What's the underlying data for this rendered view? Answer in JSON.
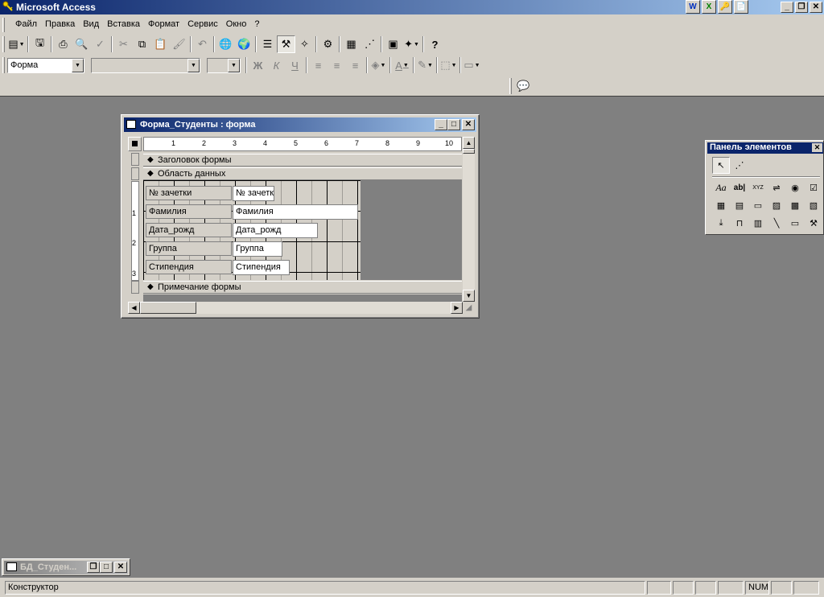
{
  "app": {
    "title": "Microsoft Access",
    "ext_icons": [
      "W",
      "X",
      "🔑",
      "📄"
    ]
  },
  "menu": {
    "items": [
      "Файл",
      "Правка",
      "Вид",
      "Вставка",
      "Формат",
      "Сервис",
      "Окно",
      "?"
    ]
  },
  "format_toolbar": {
    "object_combo": "Форма",
    "font_combo": "",
    "size_combo": "",
    "bold": "Ж",
    "italic": "К",
    "underline": "Ч"
  },
  "form_window": {
    "title": "Форма_Студенты : форма",
    "sections": {
      "header": "Заголовок формы",
      "detail": "Область данных",
      "footer": "Примечание формы"
    },
    "ruler_top": [
      "1",
      "2",
      "3",
      "4",
      "5",
      "6",
      "7",
      "8",
      "9",
      "10"
    ],
    "ruler_left": [
      "1",
      "2",
      "3"
    ],
    "fields": [
      {
        "label": "№ зачетки",
        "field": "№ зачетк"
      },
      {
        "label": "Фамилия",
        "field": "Фамилия"
      },
      {
        "label": "Дата_рожд",
        "field": "Дата_рожд"
      },
      {
        "label": "Группа",
        "field": "Группа"
      },
      {
        "label": "Стипендия",
        "field": "Стипендия"
      }
    ]
  },
  "toolbox": {
    "title": "Панель элементов",
    "aa": "Aa",
    "ab": "ab|",
    "xyz": "XYZ"
  },
  "db_window": {
    "title": "БД_Студен..."
  },
  "status": {
    "mode": "Конструктор",
    "num": "NUM"
  }
}
